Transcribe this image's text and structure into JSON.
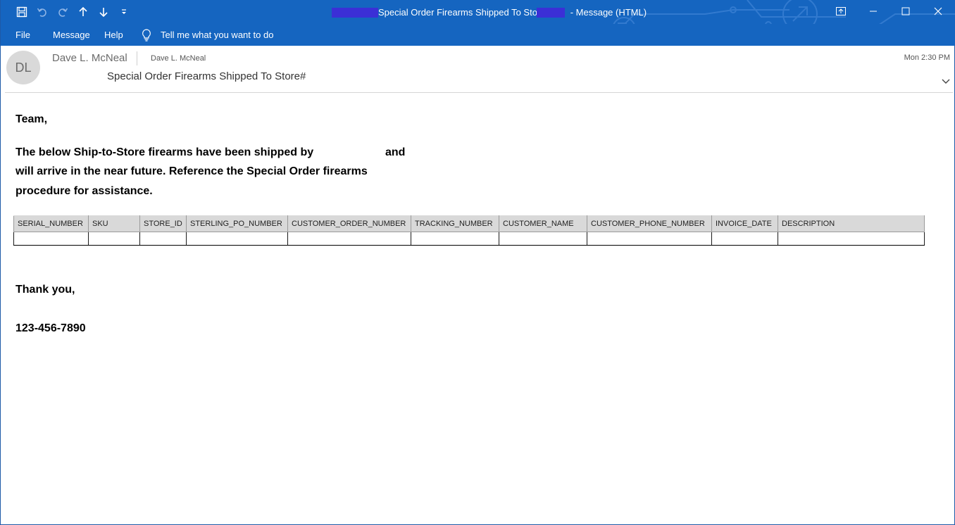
{
  "window": {
    "title": "Special Order Firearms Shipped To Store#",
    "title_suffix": "-  Message (HTML)"
  },
  "colors": {
    "titlebar": "#1565c0",
    "redaction": "#3b2fd6",
    "avatar_bg": "#d9d9d9"
  },
  "quick_access": [
    "save-icon",
    "undo-icon",
    "redo-icon",
    "previous-item-icon",
    "next-item-icon",
    "customize-toolbar-icon"
  ],
  "window_controls": [
    "ribbon-display-options-icon",
    "minimize-icon",
    "maximize-icon",
    "close-icon"
  ],
  "menu": {
    "file": "File",
    "message": "Message",
    "help": "Help",
    "tell_me": "Tell me what you want to do"
  },
  "header": {
    "avatar_initials": "DL",
    "from_name": "Dave L. McNeal",
    "from_small": "Dave L. McNeal",
    "subject": "Special Order Firearms Shipped To Store#",
    "time": "Mon 2:30 PM"
  },
  "body": {
    "greeting": "Team,",
    "line1_start": "The below Ship-to-Store firearms have been shipped by",
    "line1_end": "and",
    "line2": "will arrive in the near future. Reference the Special Order firearms",
    "line3": "procedure for assistance.",
    "closing": "Thank you,",
    "phone": "123-456-7890"
  },
  "table": {
    "columns": [
      "SERIAL_NUMBER",
      "SKU",
      "STORE_ID",
      "STERLING_PO_NUMBER",
      "CUSTOMER_ORDER_NUMBER",
      "TRACKING_NUMBER",
      "CUSTOMER_NAME",
      "CUSTOMER_PHONE_NUMBER",
      "INVOICE_DATE",
      "DESCRIPTION"
    ],
    "rows": [
      [
        "",
        "",
        "",
        "",
        "",
        "",
        "",
        "",
        "",
        ""
      ]
    ]
  }
}
